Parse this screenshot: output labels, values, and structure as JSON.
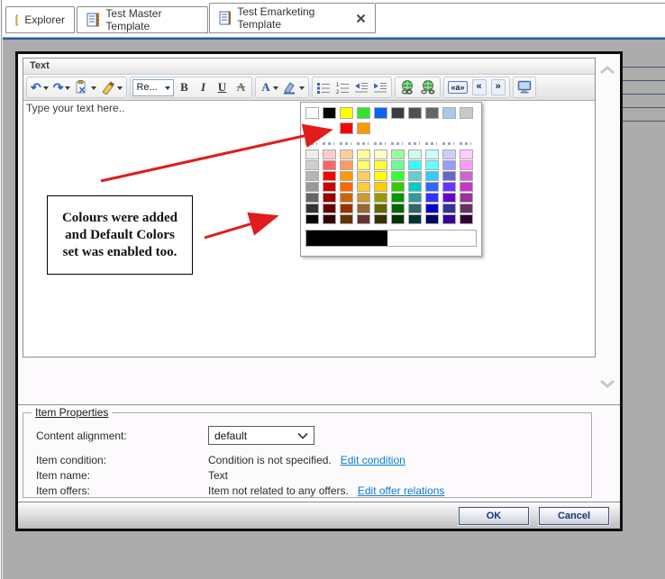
{
  "tabs": [
    {
      "label": "Explorer"
    },
    {
      "label": "Test Master Template"
    },
    {
      "label": "Test Emarketing Template",
      "closable": true
    }
  ],
  "dialog": {
    "panel_title": "Text",
    "toolbar": {
      "undo_glyph": "↶",
      "redo_glyph": "↷",
      "style_dropdown_value": "Re...",
      "bold_label": "B",
      "italic_label": "I",
      "underline_label": "U",
      "strikethrough_label": "A",
      "font_color_label": "A",
      "special_tag_label": "«a»",
      "prev_label": "«",
      "next_label": "»"
    },
    "editor": {
      "placeholder_text": "Type your text here..",
      "annotation": {
        "lines": [
          "Colours were added",
          "and Default Colors",
          "set was enabled too."
        ]
      }
    },
    "color_picker": {
      "custom_rows": [
        [
          "#FFFFFF",
          "#000000",
          "#FFFF00",
          "#2FE52F",
          "#0B63F1",
          "#3B3B3B",
          "#515151",
          "#646464",
          "#A9C9EA",
          "#C8C8C8"
        ],
        [
          null,
          null,
          "#FF0000",
          "#FF9900",
          null,
          null,
          null,
          null,
          null,
          null
        ]
      ],
      "palette_rows": [
        [
          "#EDEDED",
          "#FFCCCC",
          "#FFCC99",
          "#FFFF99",
          "#FFFFCC",
          "#99FF99",
          "#CCFFE5",
          "#CCFFFF",
          "#CCCCFF",
          "#FFCCFF"
        ],
        [
          "#CFCFCF",
          "#FF6666",
          "#FF9966",
          "#FFFF66",
          "#FFFF33",
          "#66FF99",
          "#33FFFF",
          "#66FFFF",
          "#9999FF",
          "#FF99FF"
        ],
        [
          "#B5B5B5",
          "#FF0000",
          "#FF9900",
          "#FFCC66",
          "#FFFF00",
          "#33FF33",
          "#66CCCC",
          "#33CCFF",
          "#6666CC",
          "#CC66CC"
        ],
        [
          "#999999",
          "#CC0000",
          "#FF6600",
          "#FFCC33",
          "#FFCC00",
          "#33CC00",
          "#00CCCC",
          "#3366FF",
          "#6633FF",
          "#CC33CC"
        ],
        [
          "#666666",
          "#990000",
          "#CC6600",
          "#CC9933",
          "#999900",
          "#009900",
          "#339999",
          "#3333FF",
          "#6600CC",
          "#993399"
        ],
        [
          "#333333",
          "#660000",
          "#993300",
          "#996633",
          "#666600",
          "#006600",
          "#336666",
          "#0000CC",
          "#333399",
          "#663366"
        ],
        [
          "#000000",
          "#330000",
          "#663300",
          "#663333",
          "#333300",
          "#003300",
          "#003333",
          "#000066",
          "#330099",
          "#330033"
        ]
      ],
      "preview_left_color": "#000000",
      "preview_right_color": "#FFFFFF"
    },
    "item_properties": {
      "legend": "Item Properties",
      "rows": [
        {
          "label": "Content alignment:",
          "value": "default"
        },
        {
          "label": "Item condition:",
          "value": "Condition is not specified.",
          "link": "Edit condition"
        },
        {
          "label": "Item name:",
          "value": "Text"
        },
        {
          "label": "Item offers:",
          "value": "Item not related to any offers.",
          "link": "Edit offer relations"
        }
      ]
    },
    "footer": {
      "ok_label": "OK",
      "cancel_label": "Cancel"
    }
  },
  "colors": {
    "workspace_background": "#ACACAC",
    "accent_blue": "#2F5BA5",
    "link": "#0C7CD6",
    "arrow": "#E21B1B",
    "dialog_border": "#0E0E0E"
  }
}
